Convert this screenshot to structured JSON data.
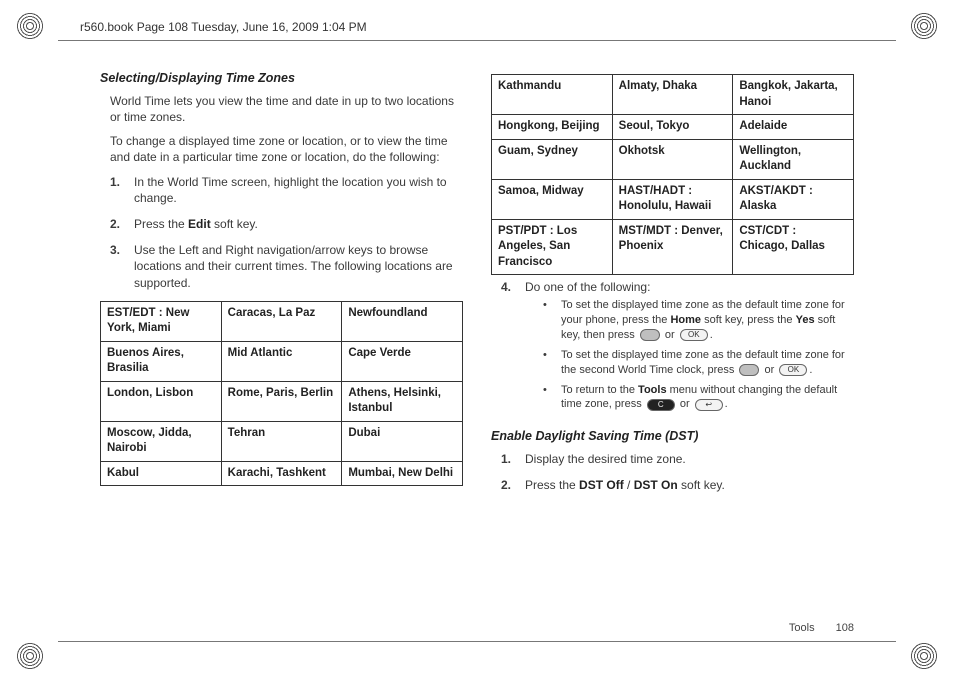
{
  "header": {
    "note": "r560.book  Page 108  Tuesday, June 16, 2009  1:04 PM"
  },
  "section1": {
    "title": "Selecting/Displaying Time Zones",
    "intro1": "World Time lets you view the time and date in up to two locations or time zones.",
    "intro2": "To change a displayed time zone or location, or to view the time and date in a particular time zone or location, do the following:",
    "step1": "In the World Time screen, highlight the location you wish to change.",
    "step2_a": "Press the ",
    "step2_b": "Edit",
    "step2_c": " soft key.",
    "step3": "Use the Left and Right navigation/arrow keys to browse locations and their current times. The following locations are supported."
  },
  "tz_table": [
    [
      "EST/EDT : New York, Miami",
      "Caracas, La Paz",
      "Newfoundland"
    ],
    [
      "Buenos Aires, Brasilia",
      "Mid Atlantic",
      "Cape Verde"
    ],
    [
      "London, Lisbon",
      "Rome, Paris, Berlin",
      "Athens, Helsinki, Istanbul"
    ],
    [
      "Moscow, Jidda, Nairobi",
      "Tehran",
      "Dubai"
    ],
    [
      "Kabul",
      "Karachi, Tashkent",
      "Mumbai, New Delhi"
    ],
    [
      "Kathmandu",
      "Almaty, Dhaka",
      "Bangkok, Jakarta, Hanoi"
    ],
    [
      "Hongkong, Beijing",
      "Seoul, Tokyo",
      "Adelaide"
    ],
    [
      "Guam, Sydney",
      "Okhotsk",
      "Wellington, Auckland"
    ],
    [
      "Samoa, Midway",
      "HAST/HADT : Honolulu, Hawaii",
      "AKST/AKDT : Alaska"
    ],
    [
      "PST/PDT : Los Angeles, San Francisco",
      "MST/MDT : Denver, Phoenix",
      "CST/CDT : Chicago, Dallas"
    ]
  ],
  "step4": {
    "lead": "Do one of the following:",
    "b1_a": "To set the displayed time zone as the default time zone for your phone, press the ",
    "b1_b": "Home",
    "b1_c": " soft key, press the ",
    "b1_d": "Yes",
    "b1_e": " soft key, then press ",
    "b1_or": " or ",
    "b1_end": ".",
    "b2_a": "To set the displayed time zone as the default time zone for the second World Time clock, press ",
    "b2_or": " or ",
    "b2_end": ".",
    "b3_a": "To return to the ",
    "b3_b": "Tools",
    "b3_c": " menu without changing the default time zone, press ",
    "b3_or": "  or  ",
    "b3_end": "."
  },
  "section2": {
    "title": "Enable Daylight Saving Time (DST)",
    "s1": "Display the desired time zone.",
    "s2_a": "Press the ",
    "s2_b": "DST Off",
    "s2_c": " / ",
    "s2_d": "DST On",
    "s2_e": " soft key."
  },
  "keys": {
    "ok": "OK",
    "c": "C",
    "back": "↩",
    "blank": " "
  },
  "footer": {
    "label": "Tools",
    "page": "108"
  }
}
